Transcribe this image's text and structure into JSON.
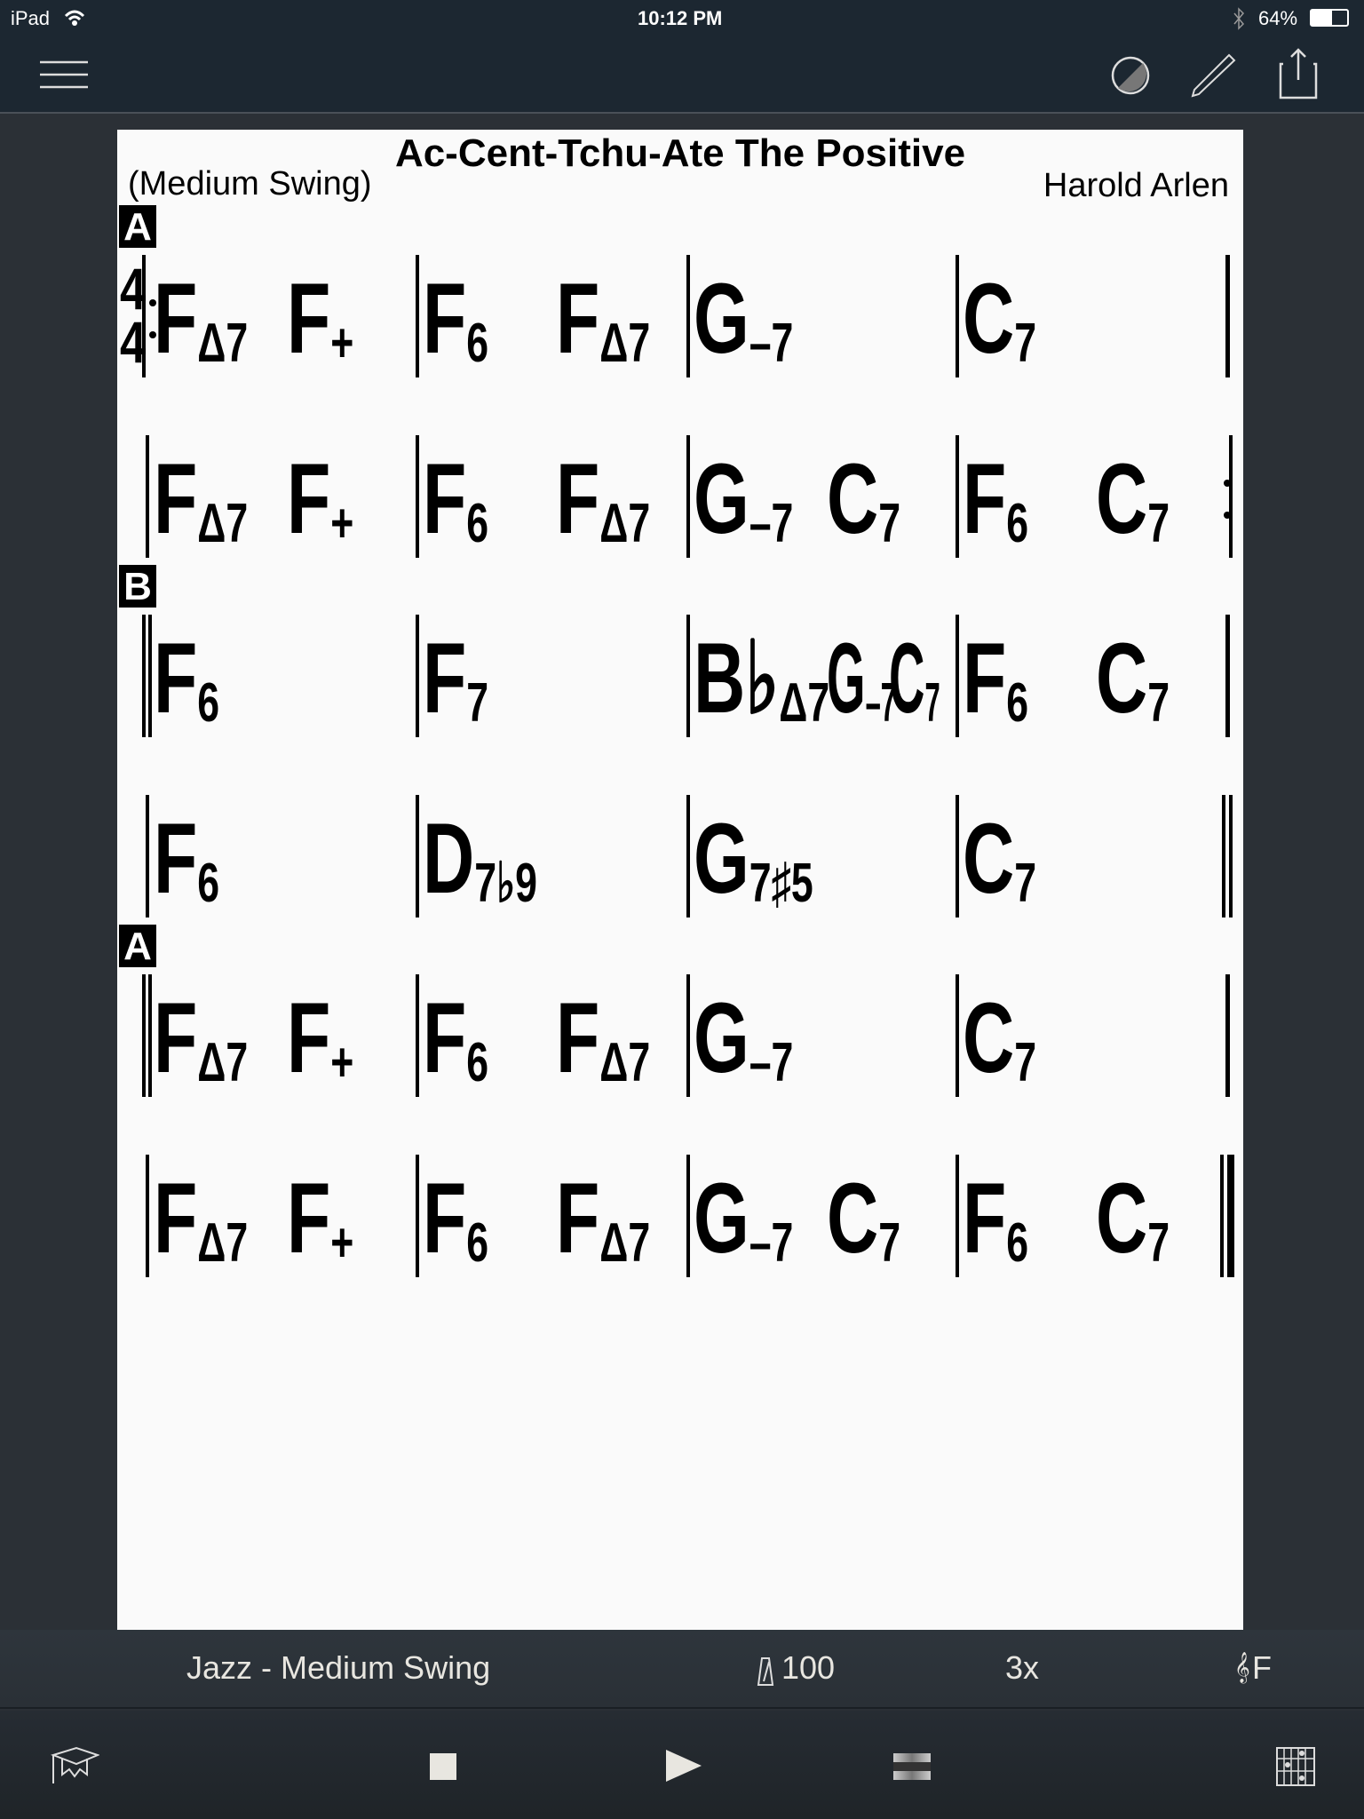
{
  "status": {
    "device": "iPad",
    "time": "10:12 PM",
    "battery": "64%",
    "battery_level": 0.64
  },
  "toolbar": {
    "icons": [
      "menu-icon",
      "contrast-icon",
      "pencil-icon",
      "share-icon"
    ]
  },
  "sheet": {
    "title": "Ac-Cent-Tchu-Ate The Positive",
    "style": "(Medium Swing)",
    "composer": "Harold Arlen",
    "time_signature": [
      "4",
      "4"
    ],
    "rows": [
      {
        "marker": "A",
        "start": "repeat-start",
        "end": "single",
        "measures": [
          [
            [
              "F",
              "Δ7"
            ],
            [
              "F",
              "+"
            ]
          ],
          [
            [
              "F",
              "6"
            ],
            [
              "F",
              "Δ7"
            ]
          ],
          [
            [
              "G",
              "–7"
            ]
          ],
          [
            [
              "C",
              "7"
            ]
          ]
        ]
      },
      {
        "marker": "",
        "start": "single",
        "end": "repeat-end",
        "measures": [
          [
            [
              "F",
              "Δ7"
            ],
            [
              "F",
              "+"
            ]
          ],
          [
            [
              "F",
              "6"
            ],
            [
              "F",
              "Δ7"
            ]
          ],
          [
            [
              "G",
              "–7"
            ],
            [
              "C",
              "7"
            ]
          ],
          [
            [
              "F",
              "6"
            ],
            [
              "C",
              "7"
            ]
          ]
        ]
      },
      {
        "marker": "B",
        "start": "double",
        "end": "single",
        "measures": [
          [
            [
              "F",
              "6"
            ]
          ],
          [
            [
              "F",
              "7"
            ]
          ],
          [
            [
              "B♭",
              "Δ7"
            ],
            [
              "G",
              "–7"
            ],
            [
              "C",
              "7"
            ]
          ],
          [
            [
              "F",
              "6"
            ],
            [
              "C",
              "7"
            ]
          ]
        ]
      },
      {
        "marker": "",
        "start": "single",
        "end": "double",
        "measures": [
          [
            [
              "F",
              "6"
            ]
          ],
          [
            [
              "D",
              "7♭9"
            ]
          ],
          [
            [
              "G",
              "7♯5"
            ]
          ],
          [
            [
              "C",
              "7"
            ]
          ]
        ]
      },
      {
        "marker": "A",
        "start": "double",
        "end": "single",
        "measures": [
          [
            [
              "F",
              "Δ7"
            ],
            [
              "F",
              "+"
            ]
          ],
          [
            [
              "F",
              "6"
            ],
            [
              "F",
              "Δ7"
            ]
          ],
          [
            [
              "G",
              "–7"
            ]
          ],
          [
            [
              "C",
              "7"
            ]
          ]
        ]
      },
      {
        "marker": "",
        "start": "single",
        "end": "final",
        "measures": [
          [
            [
              "F",
              "Δ7"
            ],
            [
              "F",
              "+"
            ]
          ],
          [
            [
              "F",
              "6"
            ],
            [
              "F",
              "Δ7"
            ]
          ],
          [
            [
              "G",
              "–7"
            ],
            [
              "C",
              "7"
            ]
          ],
          [
            [
              "F",
              "6"
            ],
            [
              "C",
              "7"
            ]
          ]
        ]
      }
    ]
  },
  "player": {
    "style": "Jazz - Medium Swing",
    "tempo": "100",
    "repeats": "3x",
    "key": "F"
  },
  "controls": [
    "mortarboard-icon",
    "stop-icon",
    "play-icon",
    "mixer-icon",
    "chord-diagram-icon"
  ]
}
